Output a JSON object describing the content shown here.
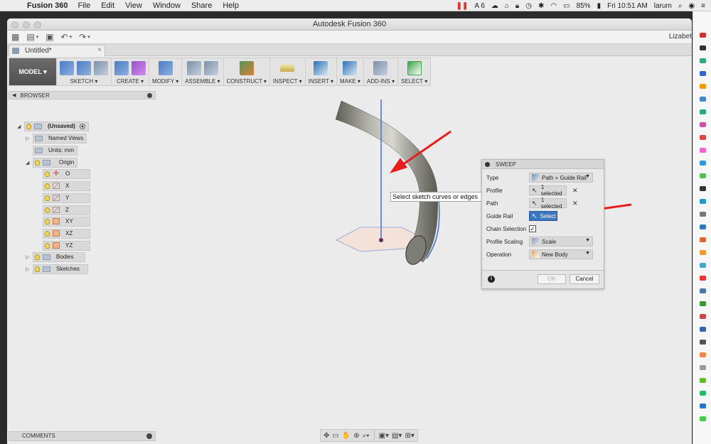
{
  "menubar": {
    "app_name": "Fusion 360",
    "items": [
      "File",
      "Edit",
      "View",
      "Window",
      "Share",
      "Help"
    ],
    "status_count": "6",
    "battery": "85%",
    "clock": "Fri 10:51 AM",
    "user": "larum"
  },
  "window": {
    "title": "Autodesk Fusion 360",
    "user_short": "Lizabet",
    "document_tab": "Untitled*"
  },
  "toolbar": {
    "workspace": "MODEL ▾",
    "groups": [
      "SKETCH ▾",
      "CREATE ▾",
      "MODIFY ▾",
      "ASSEMBLE ▾",
      "CONSTRUCT ▾",
      "INSPECT ▾",
      "INSERT ▾",
      "MAKE ▾",
      "ADD-INS ▾",
      "SELECT ▾"
    ]
  },
  "browser": {
    "title": "BROWSER",
    "root": "(Unsaved)",
    "named_views": "Named Views",
    "units": "Units: mm",
    "origin": "Origin",
    "origin_items": [
      "O",
      "X",
      "Y",
      "Z",
      "XY",
      "XZ",
      "YZ"
    ],
    "bodies": "Bodies",
    "sketches": "Sketches"
  },
  "tooltip": "Select sketch curves or edges",
  "sweep": {
    "title": "SWEEP",
    "type_label": "Type",
    "type_value": "Path + Guide Rail",
    "profile_label": "Profile",
    "profile_value": "1 selected",
    "path_label": "Path",
    "path_value": "1 selected",
    "guide_rail_label": "Guide Rail",
    "guide_rail_value": "Select",
    "chain_label": "Chain Selection",
    "scaling_label": "Profile Scaling",
    "scaling_value": "Scale",
    "operation_label": "Operation",
    "operation_value": "New Body",
    "ok": "OK",
    "cancel": "Cancel"
  },
  "comments": "COMMENTS",
  "colors": {
    "accent_blue": "#3b77c0",
    "arrow_red": "#e81e1e",
    "pipe_gray": "#8c8c84",
    "sketch_blue": "#4a6fd8"
  }
}
